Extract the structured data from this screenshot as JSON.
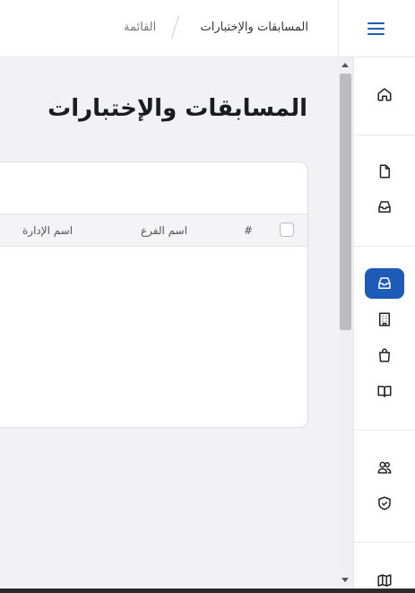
{
  "breadcrumb": {
    "current": "المسابقات والإختبارات",
    "parent": "القائمة"
  },
  "page": {
    "title": "المسابقات والإختبارات"
  },
  "table": {
    "columns": [
      "#",
      "اسم الفرع",
      "اسم الإدارة"
    ],
    "rows": []
  },
  "sidebar": {
    "items": [
      {
        "icon": "home-icon"
      },
      {
        "icon": "file-icon"
      },
      {
        "icon": "inbox-icon"
      },
      {
        "icon": "inbox-icon",
        "active": true
      },
      {
        "icon": "building-icon"
      },
      {
        "icon": "shopping-bag-icon"
      },
      {
        "icon": "book-open-icon"
      },
      {
        "icon": "users-icon"
      },
      {
        "icon": "shield-check-icon"
      },
      {
        "icon": "map-icon"
      }
    ]
  },
  "colors": {
    "accent": "#1e5bb8",
    "background": "#f2f2f4"
  }
}
